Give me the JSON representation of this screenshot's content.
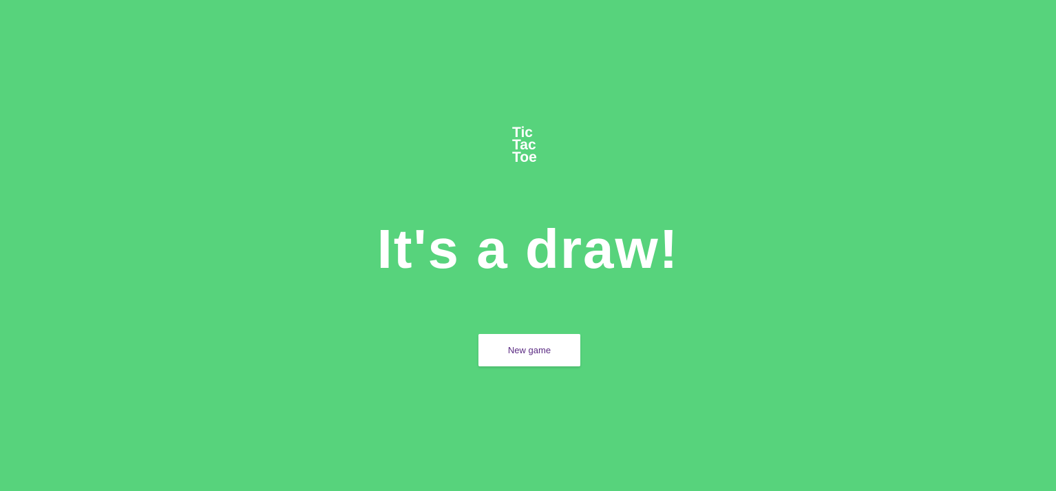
{
  "logo": {
    "line1": "Tic",
    "line2": "Tac",
    "line3": "Toe"
  },
  "result": {
    "headline": "It's a draw!"
  },
  "actions": {
    "new_game_label": "New game"
  },
  "colors": {
    "background": "#57d37c",
    "text": "#ffffff",
    "button_background": "#ffffff",
    "button_text": "#5a2a82"
  }
}
